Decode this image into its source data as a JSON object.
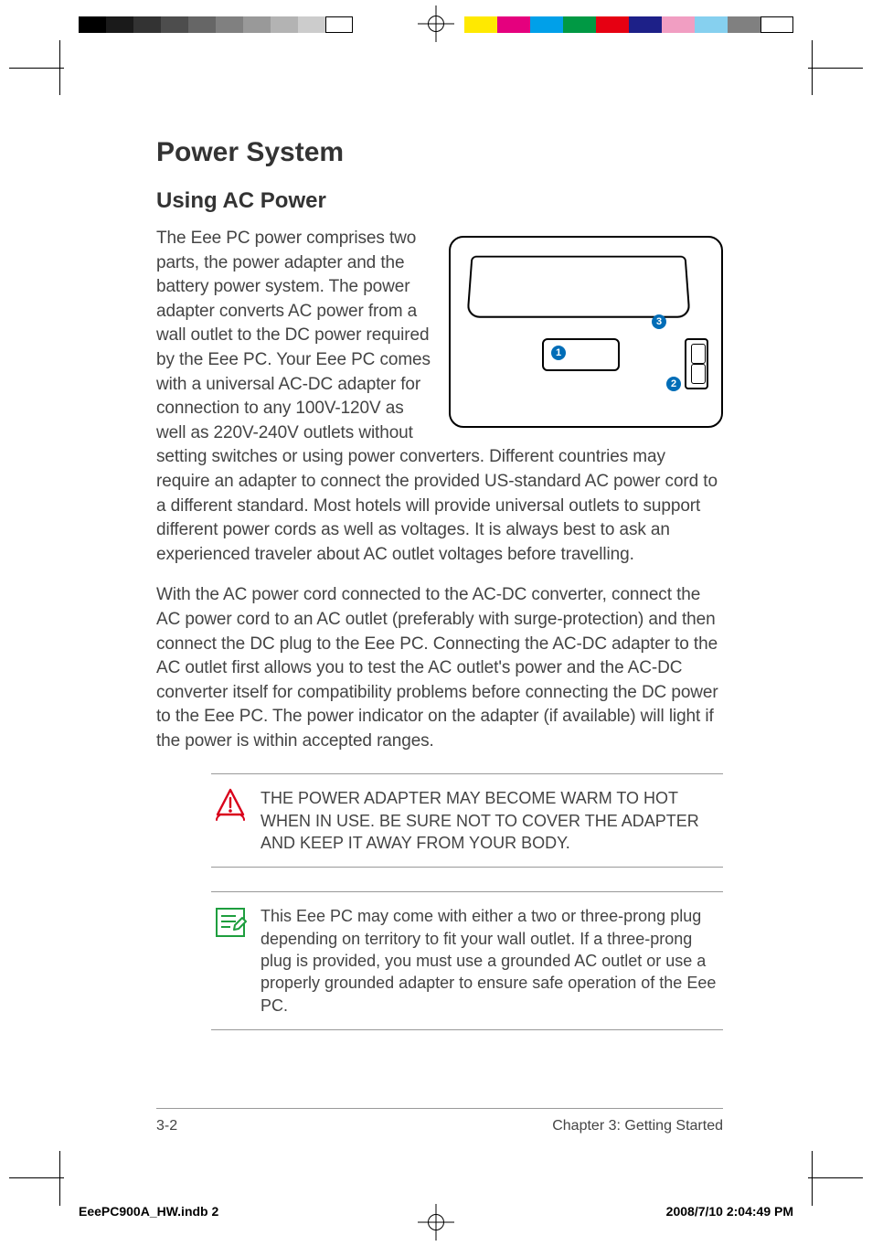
{
  "heading": "Power System",
  "subheading": "Using AC Power",
  "para1": "The Eee PC power comprises two parts, the power adapter and the battery power system. The power adapter converts AC power from a wall outlet to the DC power required by the Eee PC. Your Eee PC comes with a universal AC-DC adapter for connection to any 100V-120V as well as 220V-240V outlets without setting switches or using power converters. Different countries may require an adapter to connect the provided US-standard AC power cord to a different standard. Most hotels will provide universal outlets to support different power cords as well as voltages. It is always best to ask an experienced traveler about AC outlet voltages before travelling.",
  "para2": "With the AC power cord connected to the AC-DC converter, connect the AC power cord to an AC outlet (preferably with surge-protection) and then connect the DC plug to the Eee PC. Connecting the AC-DC adapter to the AC outlet first allows you to test the AC outlet's power and the AC-DC converter itself for compatibility problems before connecting the DC power to the Eee PC. The power indicator on the adapter (if available) will light if the power is within accepted ranges.",
  "note_warning": "THE POWER ADAPTER MAY BECOME WARM TO HOT WHEN IN USE. BE SURE NOT TO COVER THE ADAPTER AND KEEP IT AWAY FROM YOUR BODY.",
  "note_info": "This Eee PC may come with either a two or three-prong plug depending on territory to fit your wall outlet. If a three-prong plug is provided, you must use a grounded AC outlet or use a properly grounded adapter to ensure safe operation of the Eee PC.",
  "figure": {
    "callouts": [
      "1",
      "2",
      "3"
    ]
  },
  "footer": {
    "page": "3-2",
    "chapter": "Chapter 3: Getting Started"
  },
  "slug": {
    "file": "EeePC900A_HW.indb   2",
    "timestamp": "2008/7/10   2:04:49 PM"
  }
}
